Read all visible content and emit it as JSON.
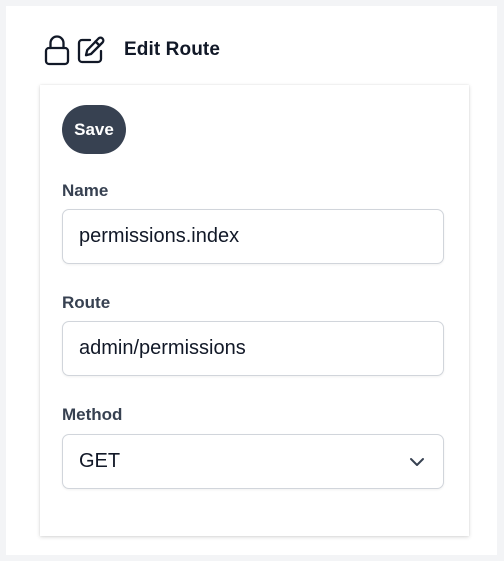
{
  "header": {
    "title": "Edit Route",
    "icons": [
      "lock-icon",
      "pencil-square-icon"
    ]
  },
  "form": {
    "save_label": "Save",
    "name": {
      "label": "Name",
      "value": "permissions.index"
    },
    "route": {
      "label": "Route",
      "value": "admin/permissions"
    },
    "method": {
      "label": "Method",
      "value": "GET",
      "icon": "chevron-down-icon"
    }
  },
  "colors": {
    "save_button_bg": "#374151",
    "label": "#374151",
    "field_border": "#d1d5db"
  }
}
